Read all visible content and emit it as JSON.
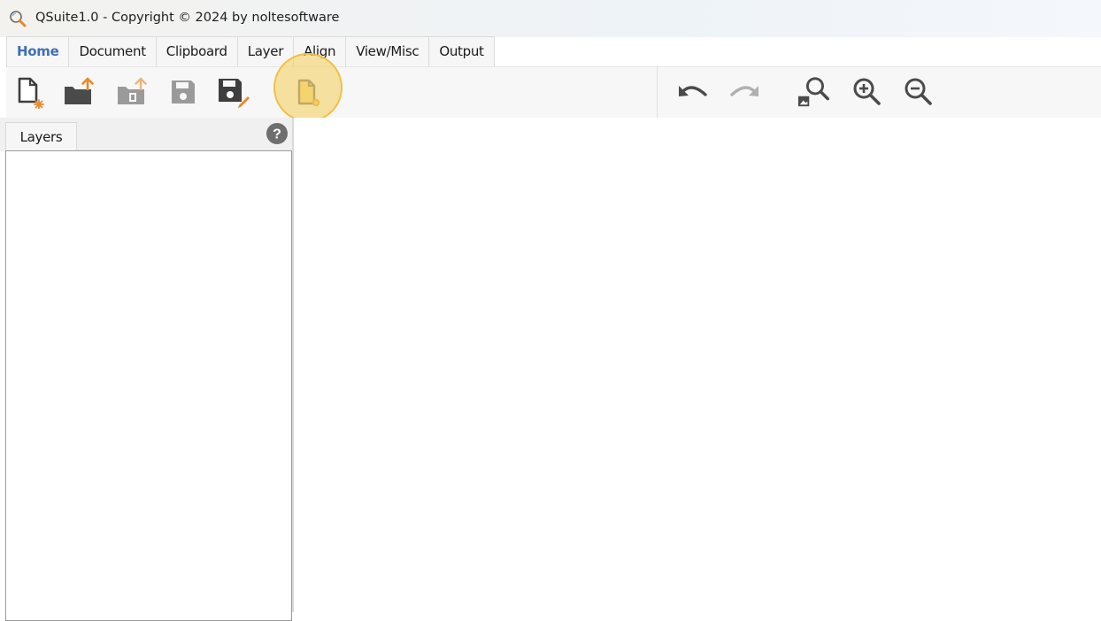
{
  "window": {
    "title": "QSuite1.0 - Copyright © 2024 by noltesoftware",
    "icon": "magnifier-app-icon"
  },
  "tabs": [
    {
      "label": "Home",
      "active": true
    },
    {
      "label": "Document",
      "active": false
    },
    {
      "label": "Clipboard",
      "active": false
    },
    {
      "label": "Layer",
      "active": false
    },
    {
      "label": "Align",
      "active": false
    },
    {
      "label": "View/Misc",
      "active": false
    },
    {
      "label": "Output",
      "active": false
    }
  ],
  "toolbar": {
    "left_buttons": [
      "new-document-icon",
      "open-folder-icon",
      "import-icon",
      "save-icon",
      "save-as-icon",
      "document-settings-icon"
    ],
    "right_buttons": [
      "undo-icon",
      "redo-icon",
      "zoom-image-icon",
      "zoom-in-icon",
      "zoom-out-icon"
    ],
    "highlighted": "document-settings-icon",
    "highlight_color": "#f6cd5a"
  },
  "left_panel": {
    "tab_label": "Layers",
    "help_icon": "help-icon"
  },
  "colors": {
    "active_tab": "#3f6fb5",
    "icon_dark": "#4a4a4a",
    "icon_accent": "#e8892b"
  }
}
